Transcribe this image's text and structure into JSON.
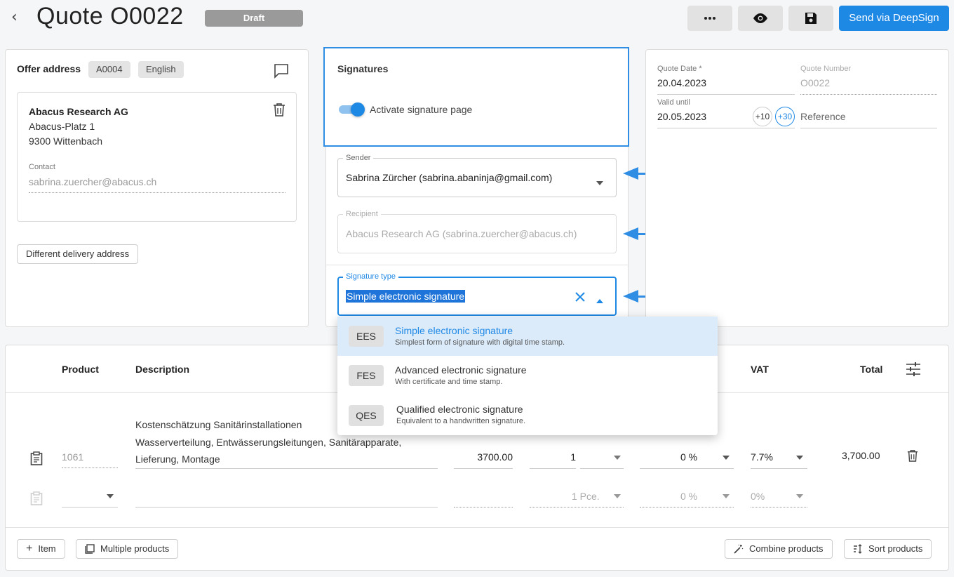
{
  "header": {
    "title": "Quote O0022",
    "status": "Draft",
    "send_label": "Send via DeepSign"
  },
  "offer": {
    "heading": "Offer address",
    "code_chip": "A0004",
    "lang_chip": "English",
    "company": "Abacus Research AG",
    "street": "Abacus-Platz 1",
    "city": "9300 Wittenbach",
    "contact_label": "Contact",
    "contact_value": "sabrina.zuercher@abacus.ch",
    "delivery_btn": "Different delivery address"
  },
  "signatures": {
    "heading": "Signatures",
    "toggle_label": "Activate signature page",
    "toggle_on": true,
    "sender_label": "Sender",
    "sender_value": "Sabrina Zürcher (sabrina.abaninja@gmail.com)",
    "recipient_label": "Recipient",
    "recipient_value": "Abacus Research AG (sabrina.zuercher@abacus.ch)",
    "type_label": "Signature type",
    "type_value": "Simple electronic signature"
  },
  "signature_options": [
    {
      "code": "EES",
      "title": "Simple electronic signature",
      "desc": "Simplest form of signature with digital time stamp."
    },
    {
      "code": "FES",
      "title": "Advanced electronic signature",
      "desc": "With certificate and time stamp."
    },
    {
      "code": "QES",
      "title": "Qualified electronic signature",
      "desc": "Equivalent to a handwritten signature."
    }
  ],
  "dates": {
    "quote_date_label": "Quote Date *",
    "quote_date": "20.04.2023",
    "quote_number_label": "Quote Number",
    "quote_number": "O0022",
    "valid_label": "Valid until",
    "valid_value": "20.05.2023",
    "plus10": "+10",
    "plus30": "+30",
    "reference_placeholder": "Reference"
  },
  "table": {
    "headers": {
      "product": "Product",
      "description": "Description",
      "vat": "VAT",
      "total": "Total"
    },
    "row1": {
      "product": "1061",
      "desc_line1": "Kostenschätzung Sanitärinstallationen",
      "desc_line2": "Wasserverteilung, Entwässerungsleitungen, Sanitärapparate,",
      "desc_line3": "Lieferung, Montage",
      "price": "3700.00",
      "qty": "1",
      "discount": "0 %",
      "vat": "7.7%",
      "total": "3,700.00"
    },
    "row2": {
      "qty": "1 Pce.",
      "discount": "0 %",
      "vat": "0%"
    }
  },
  "footer": {
    "item_btn": "Item",
    "multi_btn": "Multiple products",
    "combine_btn": "Combine products",
    "sort_btn": "Sort products"
  },
  "colors": {
    "accent": "#1e88e5",
    "arrow": "#2f8de4",
    "selected_bg": "#dcebfa"
  }
}
